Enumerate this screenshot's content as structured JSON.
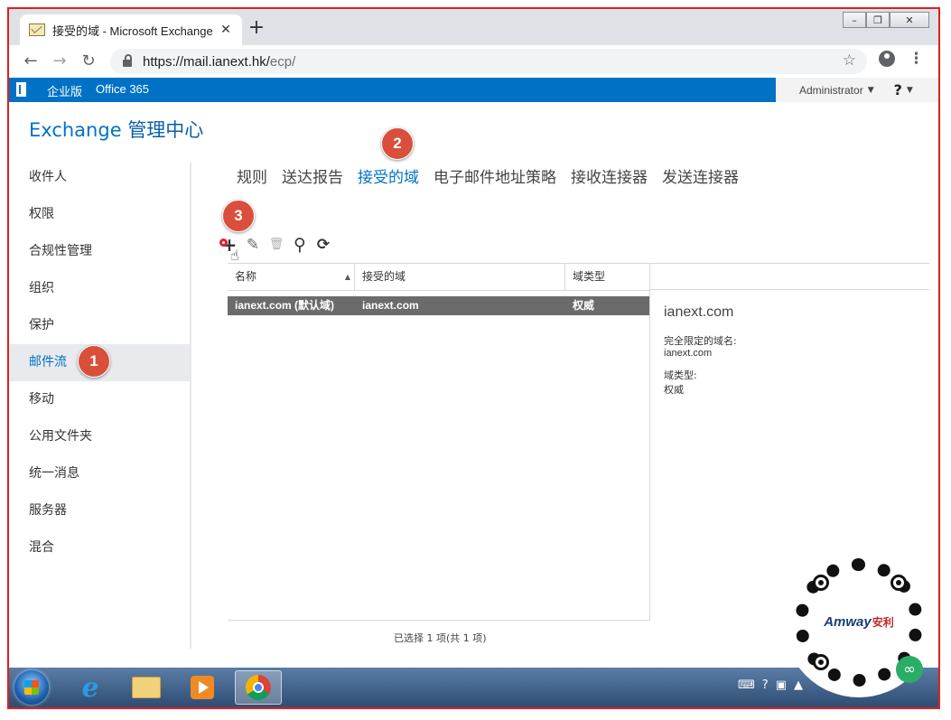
{
  "browser": {
    "tab_title": "接受的域 - Microsoft Exchange",
    "tab_close": "✕",
    "new_tab": "+",
    "url_host": "https://mail.ianext.hk/",
    "url_path": "ecp/",
    "back": "←",
    "forward": "→",
    "reload": "↻",
    "star": "☆",
    "menu": "⋮",
    "win_min": "–",
    "win_max": "❐",
    "win_close": "✕"
  },
  "office_bar": {
    "brand": "企业版",
    "product": "Office 365",
    "user": "Administrator",
    "help": "?"
  },
  "eac": {
    "title_prefix": "Exchange",
    "title_main": "管理中心"
  },
  "left_nav": [
    {
      "label": "收件人"
    },
    {
      "label": "权限"
    },
    {
      "label": "合规性管理"
    },
    {
      "label": "组织"
    },
    {
      "label": "保护"
    },
    {
      "label": "邮件流",
      "active": true
    },
    {
      "label": "移动"
    },
    {
      "label": "公用文件夹"
    },
    {
      "label": "统一消息"
    },
    {
      "label": "服务器"
    },
    {
      "label": "混合"
    }
  ],
  "tabs": [
    {
      "label": "规则"
    },
    {
      "label": "送达报告"
    },
    {
      "label": "接受的域",
      "active": true
    },
    {
      "label": "电子邮件地址策略"
    },
    {
      "label": "接收连接器"
    },
    {
      "label": "发送连接器"
    }
  ],
  "toolbar": {
    "add": "+",
    "edit": "✎",
    "delete": "🗑",
    "search": "⚲",
    "refresh": "⟳"
  },
  "grid": {
    "columns": [
      "名称",
      "接受的域",
      "域类型"
    ],
    "sort_indicator": "▲",
    "rows": [
      {
        "name": "ianext.com (默认域)",
        "domain": "ianext.com",
        "type": "权威",
        "selected": true
      }
    ]
  },
  "details": {
    "title": "ianext.com",
    "fqdn_label": "完全限定的域名:",
    "fqdn_value": "ianext.com",
    "type_label": "域类型:",
    "type_value": "权威"
  },
  "status": "已选择 1 项(共 1 项)",
  "annotations": {
    "step1": "1",
    "step2": "2",
    "step3": "3"
  },
  "qr": {
    "brand": "Amway",
    "brand_cn": "安利"
  },
  "icons": {
    "cursor": "hand-pointer-icon",
    "start": "windows-start-icon",
    "ie": "internet-explorer-icon",
    "explorer": "file-explorer-icon",
    "media": "media-player-icon",
    "chrome": "chrome-icon"
  },
  "colors": {
    "accent": "#0072c6",
    "badge": "#d94f3b",
    "selected_row": "#6b6b6b",
    "frame_border": "#e02020"
  }
}
